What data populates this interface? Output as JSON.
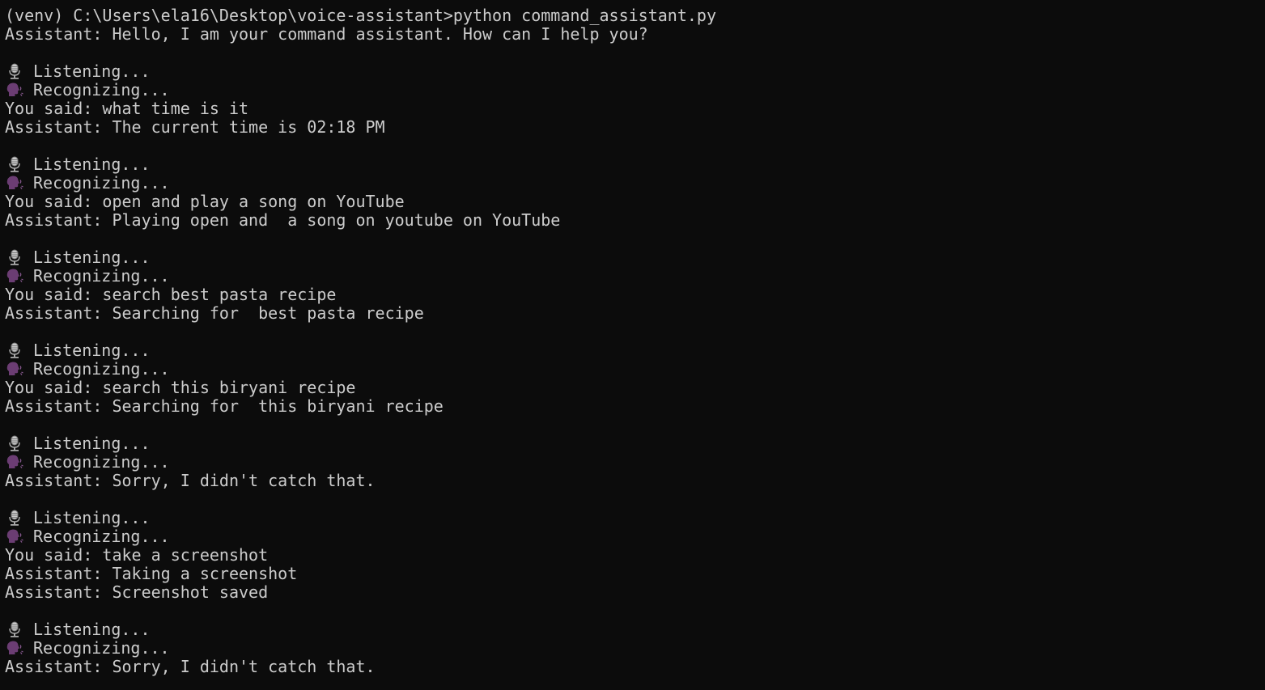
{
  "terminal": {
    "background_color": "#0c0c0c",
    "text_color": "#cccccc",
    "lines": [
      {
        "text": "(venv) C:\\Users\\ela16\\Desktop\\voice-assistant>python command_assistant.py"
      },
      {
        "text": "Assistant: Hello, I am your command assistant. How can I help you?"
      },
      {
        "text": ""
      },
      {
        "icon": "microphone-icon",
        "text": "Listening..."
      },
      {
        "icon": "speaking-head-icon",
        "text": "Recognizing..."
      },
      {
        "text": "You said: what time is it"
      },
      {
        "text": "Assistant: The current time is 02:18 PM"
      },
      {
        "text": ""
      },
      {
        "icon": "microphone-icon",
        "text": "Listening..."
      },
      {
        "icon": "speaking-head-icon",
        "text": "Recognizing..."
      },
      {
        "text": "You said: open and play a song on YouTube"
      },
      {
        "text": "Assistant: Playing open and  a song on youtube on YouTube"
      },
      {
        "text": ""
      },
      {
        "icon": "microphone-icon",
        "text": "Listening..."
      },
      {
        "icon": "speaking-head-icon",
        "text": "Recognizing..."
      },
      {
        "text": "You said: search best pasta recipe"
      },
      {
        "text": "Assistant: Searching for  best pasta recipe"
      },
      {
        "text": ""
      },
      {
        "icon": "microphone-icon",
        "text": "Listening..."
      },
      {
        "icon": "speaking-head-icon",
        "text": "Recognizing..."
      },
      {
        "text": "You said: search this biryani recipe"
      },
      {
        "text": "Assistant: Searching for  this biryani recipe"
      },
      {
        "text": ""
      },
      {
        "icon": "microphone-icon",
        "text": "Listening..."
      },
      {
        "icon": "speaking-head-icon",
        "text": "Recognizing..."
      },
      {
        "text": "Assistant: Sorry, I didn't catch that."
      },
      {
        "text": ""
      },
      {
        "icon": "microphone-icon",
        "text": "Listening..."
      },
      {
        "icon": "speaking-head-icon",
        "text": "Recognizing..."
      },
      {
        "text": "You said: take a screenshot"
      },
      {
        "text": "Assistant: Taking a screenshot"
      },
      {
        "text": "Assistant: Screenshot saved"
      },
      {
        "text": ""
      },
      {
        "icon": "microphone-icon",
        "text": "Listening..."
      },
      {
        "icon": "speaking-head-icon",
        "text": "Recognizing..."
      },
      {
        "text": "Assistant: Sorry, I didn't catch that."
      }
    ]
  }
}
